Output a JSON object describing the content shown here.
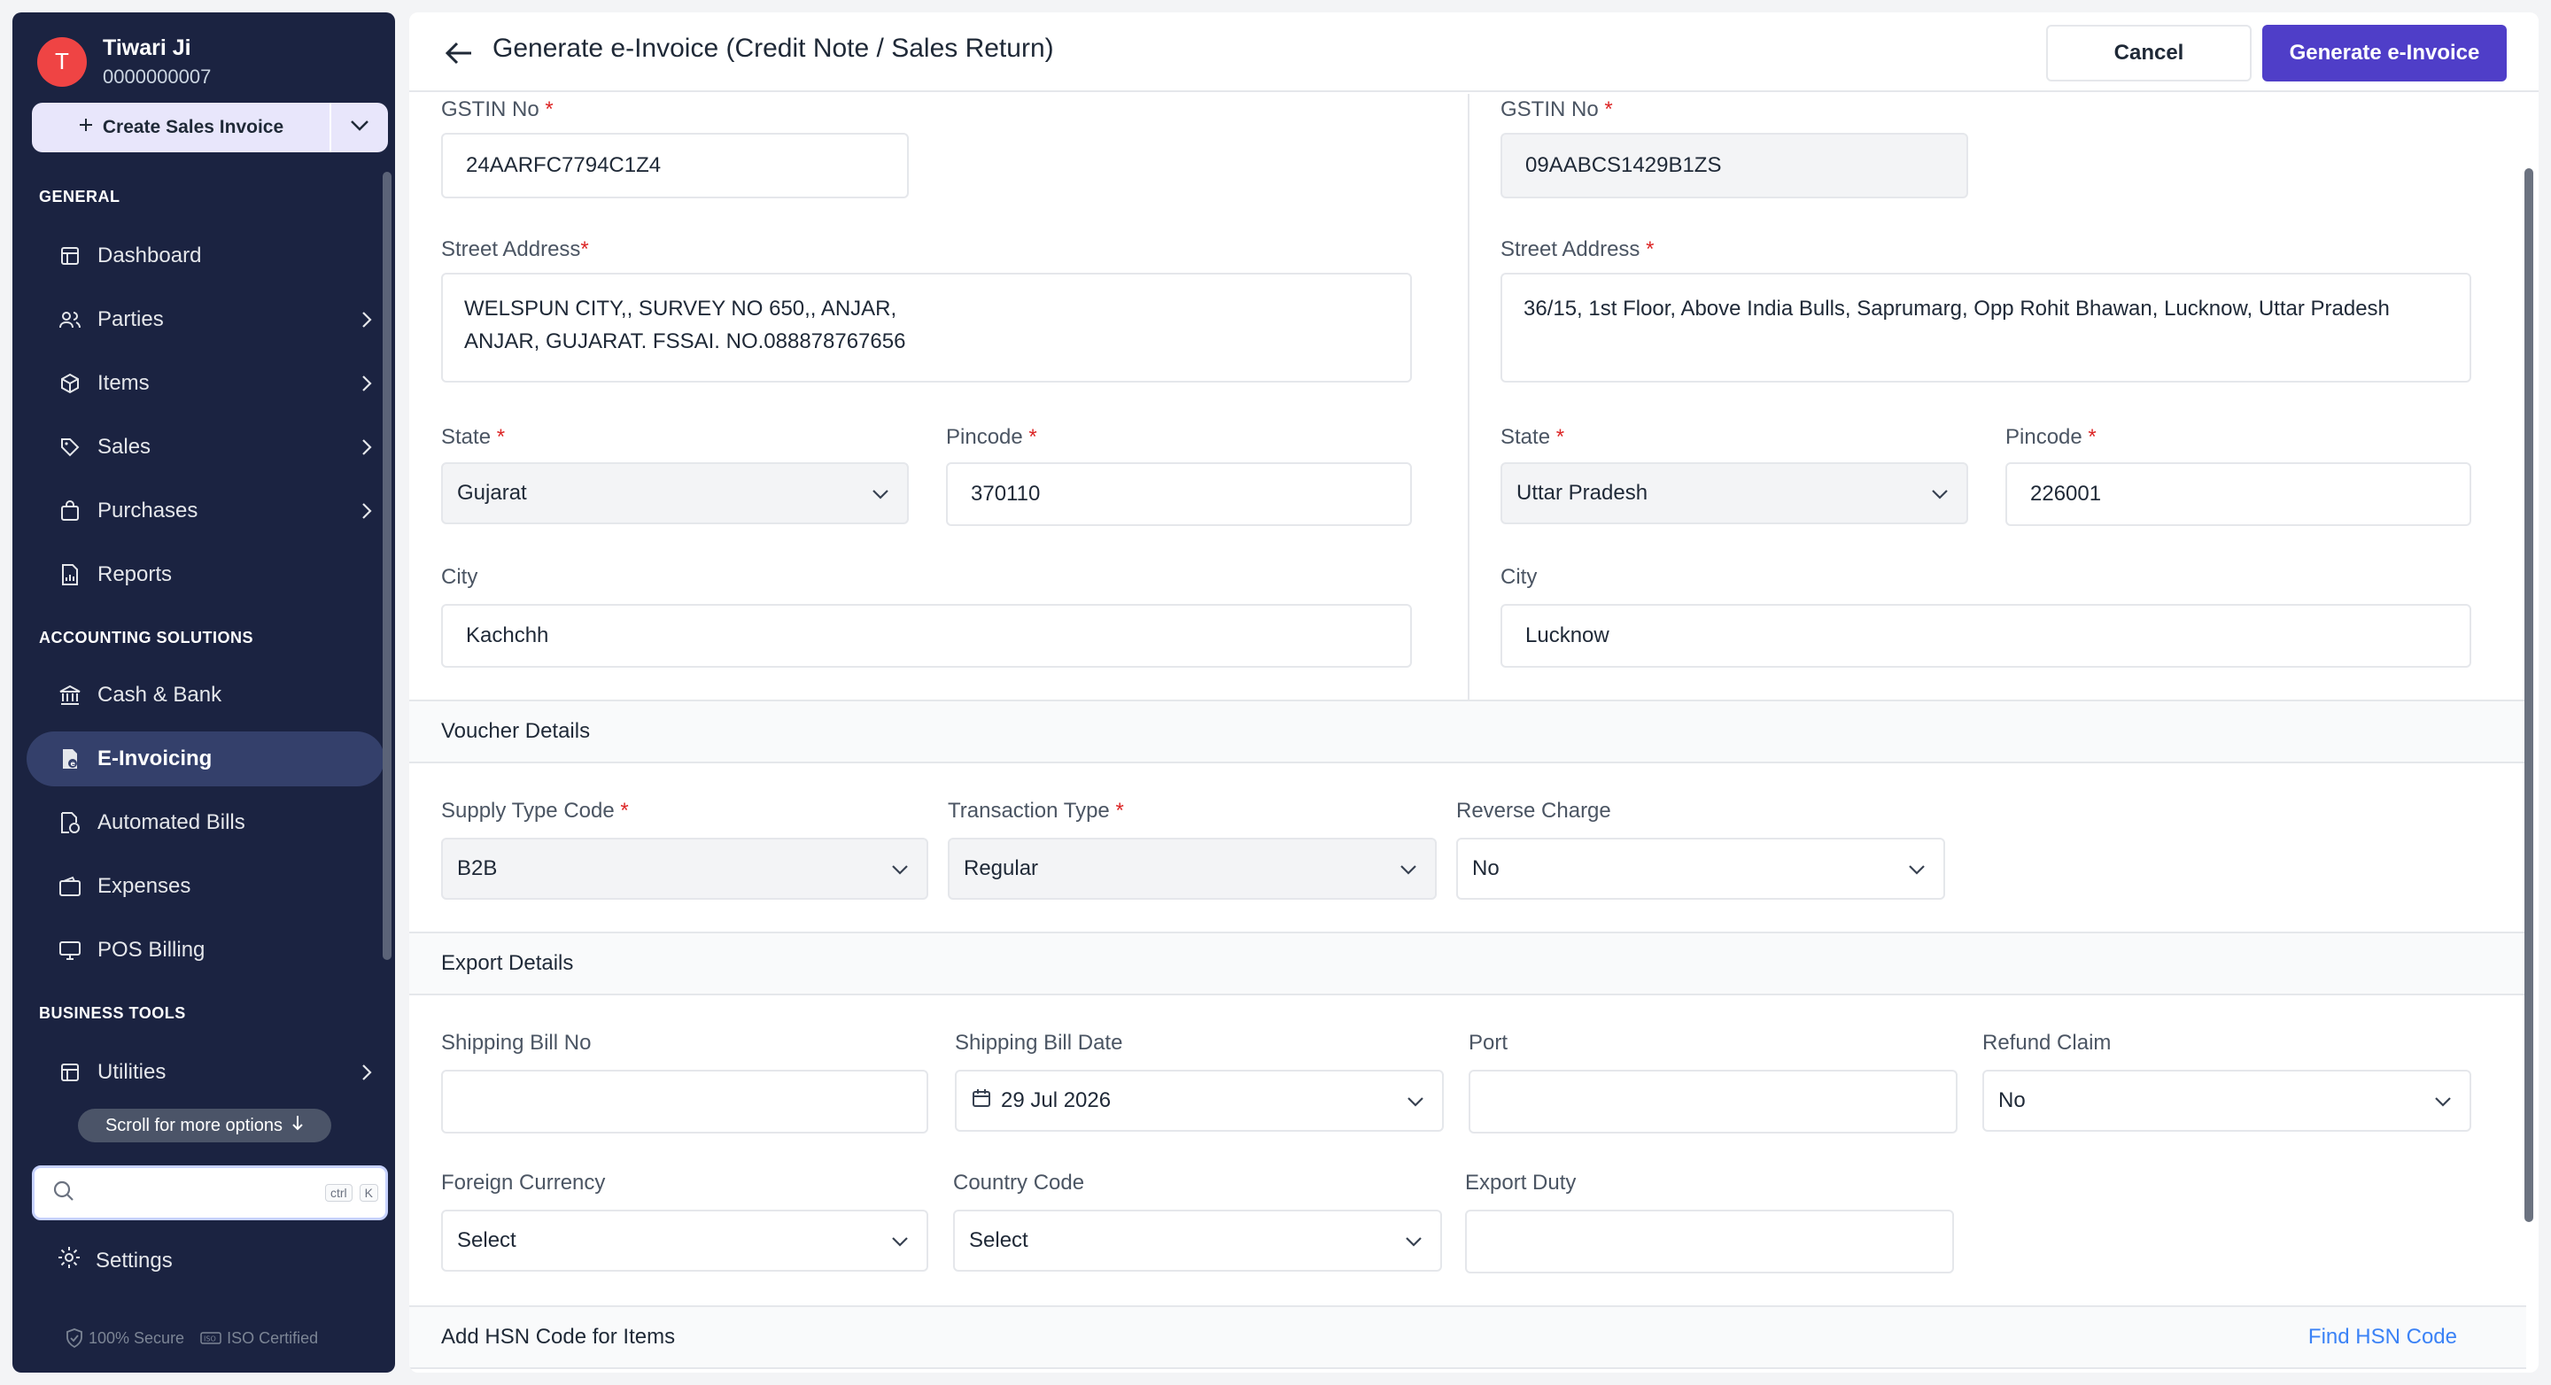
{
  "user": {
    "initial": "T",
    "name": "Tiwari Ji",
    "phone": "0000000007"
  },
  "create_button": {
    "label": "Create Sales Invoice"
  },
  "sections": {
    "general": "GENERAL",
    "accounting": "ACCOUNTING SOLUTIONS",
    "business": "BUSINESS TOOLS"
  },
  "nav": {
    "dashboard": "Dashboard",
    "parties": "Parties",
    "items": "Items",
    "sales": "Sales",
    "purchases": "Purchases",
    "reports": "Reports",
    "cash_bank": "Cash & Bank",
    "einvoicing": "E-Invoicing",
    "automated_bills": "Automated Bills",
    "expenses": "Expenses",
    "pos_billing": "POS Billing",
    "utilities": "Utilities"
  },
  "scroll_hint": "Scroll for more options",
  "search": {
    "shortcut_ctrl": "ctrl",
    "shortcut_key": "K",
    "placeholder": ""
  },
  "settings": "Settings",
  "trust": {
    "secure": "100% Secure",
    "iso": "ISO Certified"
  },
  "header": {
    "title": "Generate e-Invoice (Credit Note / Sales Return)",
    "cancel": "Cancel",
    "generate": "Generate e-Invoice"
  },
  "labels": {
    "gstin": "GSTIN No",
    "street": "Street Address",
    "state": "State",
    "pincode": "Pincode",
    "city": "City",
    "supply_type": "Supply Type Code",
    "transaction_type": "Transaction Type",
    "reverse_charge": "Reverse Charge",
    "shipping_bill_no": "Shipping Bill No",
    "shipping_bill_date": "Shipping Bill Date",
    "port": "Port",
    "refund_claim": "Refund Claim",
    "foreign_currency": "Foreign Currency",
    "country_code": "Country Code",
    "export_duty": "Export Duty"
  },
  "seller": {
    "gstin": "24AARFC7794C1Z4",
    "street_line1": "WELSPUN CITY,, SURVEY NO 650,, ANJAR,",
    "street_line2": "ANJAR, GUJARAT. FSSAI. NO.088878767656",
    "state": "Gujarat",
    "pincode": "370110",
    "city": "Kachchh"
  },
  "buyer": {
    "gstin": "09AABCS1429B1ZS",
    "street": "36/15, 1st Floor, Above India Bulls, Saprumarg, Opp Rohit Bhawan, Lucknow, Uttar Pradesh",
    "state": "Uttar Pradesh",
    "pincode": "226001",
    "city": "Lucknow"
  },
  "voucher": {
    "title": "Voucher Details",
    "supply_type": "B2B",
    "transaction_type": "Regular",
    "reverse_charge": "No"
  },
  "export": {
    "title": "Export Details",
    "shipping_bill_no": "",
    "shipping_bill_date": "29 Jul 2026",
    "port": "",
    "refund_claim": "No",
    "foreign_currency": "Select",
    "country_code": "Select",
    "export_duty": ""
  },
  "hsn": {
    "title": "Add HSN Code for Items",
    "find_link": "Find HSN Code"
  },
  "colors": {
    "sidebar_bg": "#1b2341",
    "primary": "#4f3ec8",
    "link": "#3b82f6",
    "required": "#dc2626",
    "avatar": "#ef4444"
  }
}
